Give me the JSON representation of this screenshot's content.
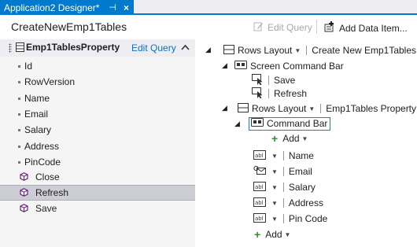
{
  "tab": {
    "title": "Application2 Designer*",
    "pin": "⊣",
    "close": "×"
  },
  "toolbar": {
    "title": "CreateNewEmp1Tables",
    "edit_query": "Edit Query",
    "add_data_item": "Add Data Item..."
  },
  "left": {
    "header_name": "Emp1TablesProperty",
    "header_edit": "Edit Query",
    "properties": [
      "Id",
      "RowVersion",
      "Name",
      "Email",
      "Salary",
      "Address",
      "PinCode"
    ],
    "commands": [
      "Close",
      "Refresh",
      "Save"
    ]
  },
  "tree": {
    "root_layout": "Rows Layout",
    "root_name": "Create New Emp1Tables",
    "screen_command_bar": "Screen Command Bar",
    "save": "Save",
    "refresh": "Refresh",
    "inner_layout": "Rows Layout",
    "inner_name": "Emp1Tables Property",
    "command_bar": "Command Bar",
    "add_inner": "Add",
    "fields": [
      {
        "label": "Name",
        "icon": "textbox-icon"
      },
      {
        "label": "Email",
        "icon": "email-address-icon"
      },
      {
        "label": "Salary",
        "icon": "textbox-icon"
      },
      {
        "label": "Address",
        "icon": "textbox-icon"
      },
      {
        "label": "Pin Code",
        "icon": "textbox-icon"
      }
    ],
    "add_outer": "Add"
  },
  "colors": {
    "accent": "#007acc",
    "link": "#0e70c0",
    "selected": "#cdcdd6",
    "add_green": "#388a34"
  }
}
